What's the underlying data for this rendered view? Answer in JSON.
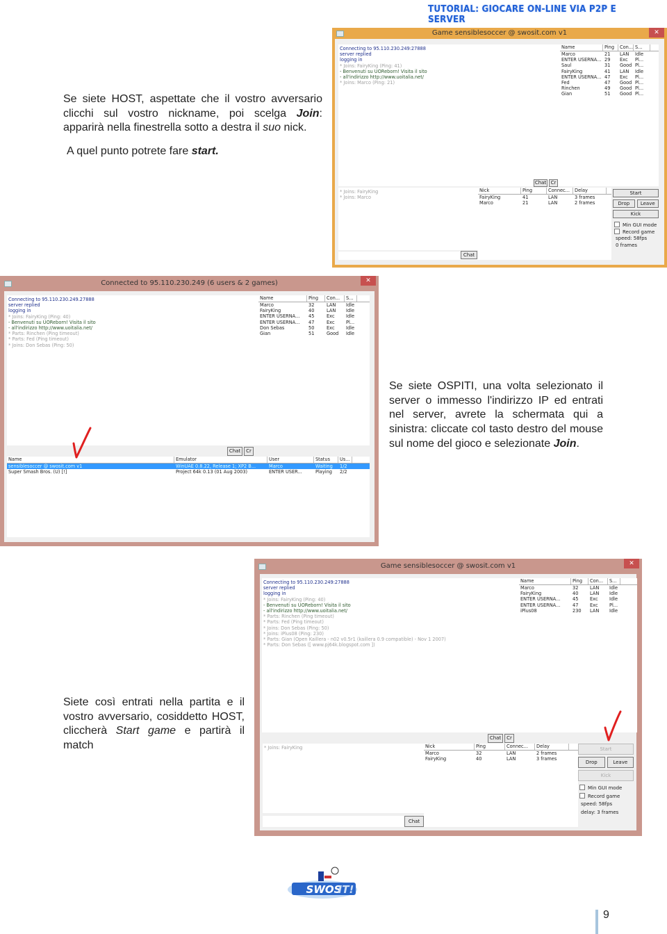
{
  "header": {
    "title": "TUTORIAL: GIOCARE ON-LINE VIA P2P E SERVER"
  },
  "paragraphs": {
    "host": {
      "text_before": "Se siete HOST, aspettate che il vostro avversario clicchi sul vostro nickname, poi scelga ",
      "bold": "Join",
      "text_mid": ": apparirà nella finestrella sotto a destra il ",
      "italic": "suo",
      "text_after": " nick."
    },
    "start": {
      "text_before": "A quel punto potrete fare ",
      "bold": "start."
    },
    "guest": {
      "text_before": "Se siete OSPITI, una volta selezionato il server o immesso l'indirizzo IP ed entrati nel server, avrete la schermata qui a sinistra: cliccate col tasto destro del mouse sul nome del gioco e selezionate ",
      "bold": "Join",
      "text_after": "."
    },
    "match": {
      "text_before": "Siete così entrati nella partita e il vostro avversario, cosiddetto HOST, cliccherà ",
      "italic1": "Start",
      "mid": " ",
      "italic2": "game",
      "text_after": " e partirà il match"
    }
  },
  "windows": [
    {
      "title": "Game sensiblesoccer @ swosit.com v1",
      "border_color": "#e9a94a",
      "log": [
        {
          "text": "Connecting to 95.110.230.249:27888",
          "kind": "system"
        },
        {
          "text": "server replied",
          "kind": "system"
        },
        {
          "text": "logging in",
          "kind": "system"
        },
        {
          "text": "* Joins: FairyKing (Ping: 41)",
          "kind": "event"
        },
        {
          "text": "- Benvenuti su UOReborn! Visita il sito",
          "kind": "motd"
        },
        {
          "text": "- all'indirizzo http://www.uoitalia.net/",
          "kind": "motd"
        },
        {
          "text": "* Joins: Marco (Ping: 21)",
          "kind": "event"
        }
      ],
      "users": {
        "columns": [
          "Name",
          "Ping",
          "Con...",
          "S..."
        ],
        "rows": [
          [
            "Marco",
            "21",
            "LAN",
            "Idle"
          ],
          [
            "ENTER USERNA...",
            "29",
            "Exc",
            "Pl..."
          ],
          [
            "Saul",
            "31",
            "Good",
            "Pl..."
          ],
          [
            "FairyKing",
            "41",
            "LAN",
            "Idle"
          ],
          [
            "ENTER USERNA...",
            "47",
            "Exc",
            "Pl..."
          ],
          [
            "Fed",
            "47",
            "Good",
            "Pl..."
          ],
          [
            "Rinchen",
            "49",
            "Good",
            "Pl..."
          ],
          [
            "Gian",
            "51",
            "Good",
            "Pl..."
          ]
        ]
      },
      "chat_button": "Chat",
      "clear_button": "Cr",
      "game_log": [
        {
          "text": "* Joins: FairyKing",
          "kind": "event"
        },
        {
          "text": "* Joins: Marco",
          "kind": "event"
        }
      ],
      "game_chat_button": "Chat",
      "players": {
        "columns": [
          "Nick",
          "Ping",
          "Connec...",
          "Delay"
        ],
        "rows": [
          [
            "FairyKing",
            "41",
            "LAN",
            "3 frames"
          ],
          [
            "Marco",
            "21",
            "LAN",
            "2 frames"
          ]
        ]
      },
      "controls": {
        "start": "Start",
        "start_enabled": true,
        "drop": "Drop",
        "leave": "Leave",
        "kick": "Kick",
        "kick_enabled": true,
        "min_gui": "Min GUI mode",
        "min_gui_checked": false,
        "record": "Record game",
        "record_checked": false,
        "speed": "speed: 58fps",
        "info": "0 frames"
      }
    },
    {
      "title": "Connected to 95.110.230.249 (6 users & 2 games)",
      "border_color": "#c9978d",
      "log": [
        {
          "text": "Connecting to 95.110.230.249.27888",
          "kind": "system"
        },
        {
          "text": "server replied",
          "kind": "system"
        },
        {
          "text": "logging in",
          "kind": "system"
        },
        {
          "text": "* Joins: FairyKing (Ping: 40)",
          "kind": "event"
        },
        {
          "text": "- Benvenuti su UOReborn! Visita il sito",
          "kind": "motd"
        },
        {
          "text": "- all'indirizzo http://www.uoitalia.net/",
          "kind": "motd"
        },
        {
          "text": "* Parts: Rinchen (Ping timeout)",
          "kind": "event"
        },
        {
          "text": "* Parts: Fed (Ping timeout)",
          "kind": "event"
        },
        {
          "text": "* Joins: Don Sebas (Ping: 50)",
          "kind": "event"
        }
      ],
      "users": {
        "columns": [
          "Name",
          "Ping",
          "Con...",
          "S..."
        ],
        "rows": [
          [
            "Marco",
            "32",
            "LAN",
            "Idle"
          ],
          [
            "FairyKing",
            "40",
            "LAN",
            "Idle"
          ],
          [
            "ENTER USERNA...",
            "45",
            "Exc",
            "Idle"
          ],
          [
            "ENTER USERNA...",
            "47",
            "Exc",
            "Pl..."
          ],
          [
            "Don Sebas",
            "50",
            "Exc",
            "Idle"
          ],
          [
            "Gian",
            "51",
            "Good",
            "Idle"
          ]
        ]
      },
      "chat_button": "Chat",
      "clear_button": "Cr",
      "games": {
        "columns": [
          "Name",
          "Emulator",
          "User",
          "Status",
          "Us..."
        ],
        "rows": [
          [
            "sensiblesoccer @ swosit.com v1",
            "WinUAE 0.8.22, Release 1; XP2 B...",
            "Marco",
            "Waiting",
            "1/2"
          ],
          [
            "Super Smash Bros. (U) [!]",
            "Project 64k 0.13 (01 Aug 2003)",
            "ENTER USER...",
            "Playing",
            "2/2"
          ]
        ],
        "selected_row": 0
      }
    },
    {
      "title": "Game sensiblesoccer @ swosit.com v1",
      "border_color": "#c9978d",
      "log": [
        {
          "text": "Connecting to 95.110.230.249:27888",
          "kind": "system"
        },
        {
          "text": "server replied",
          "kind": "system"
        },
        {
          "text": "logging in",
          "kind": "system"
        },
        {
          "text": "* Joins: FairyKing (Ping: 40)",
          "kind": "event"
        },
        {
          "text": "- Benvenuti su UOReborn! Visita il sito",
          "kind": "motd"
        },
        {
          "text": "- all'indirizzo http://www.uoitalia.net/",
          "kind": "motd"
        },
        {
          "text": "* Parts: Rinchen (Ping timeout)",
          "kind": "event"
        },
        {
          "text": "* Parts: Fed (Ping timeout)",
          "kind": "event"
        },
        {
          "text": "* Joins: Don Sebas (Ping: 50)",
          "kind": "event"
        },
        {
          "text": "* Joins: iPlus08 (Ping: 230)",
          "kind": "event"
        },
        {
          "text": "* Parts: Gian (Open Kaillera - n02 v0.5r1 (kaillera 0.9 compatible) - Nov  1 2007)",
          "kind": "event"
        },
        {
          "text": "* Parts: Don Sebas ([ www.pj64k.blogspot.com ])",
          "kind": "event"
        }
      ],
      "users": {
        "columns": [
          "Name",
          "Ping",
          "Con...",
          "S..."
        ],
        "rows": [
          [
            "Marco",
            "32",
            "LAN",
            "Idle"
          ],
          [
            "FairyKing",
            "40",
            "LAN",
            "Idle"
          ],
          [
            "ENTER USERNA...",
            "45",
            "Exc",
            "Idle"
          ],
          [
            "ENTER USERNA...",
            "47",
            "Exc",
            "Pl..."
          ],
          [
            "iPlus08",
            "230",
            "LAN",
            "Idle"
          ]
        ]
      },
      "chat_button": "Chat",
      "clear_button": "Cr",
      "game_log": [
        {
          "text": "* Joins: FairyKing",
          "kind": "event"
        }
      ],
      "game_chat_button": "Chat",
      "players": {
        "columns": [
          "Nick",
          "Ping",
          "Connec...",
          "Delay"
        ],
        "rows": [
          [
            "Marco",
            "32",
            "LAN",
            "2 frames"
          ],
          [
            "FairyKing",
            "40",
            "LAN",
            "3 frames"
          ]
        ]
      },
      "controls": {
        "start": "Start",
        "start_enabled": false,
        "drop": "Drop",
        "leave": "Leave",
        "kick": "Kick",
        "kick_enabled": false,
        "min_gui": "Min GUI mode",
        "min_gui_checked": false,
        "record": "Record game",
        "record_checked": false,
        "speed": "speed: 58fps",
        "info": "delay: 3 frames"
      }
    }
  ],
  "annotation_color": "#e02020",
  "footer": {
    "logo_text": "SWOS IT!",
    "page_number": "9"
  }
}
